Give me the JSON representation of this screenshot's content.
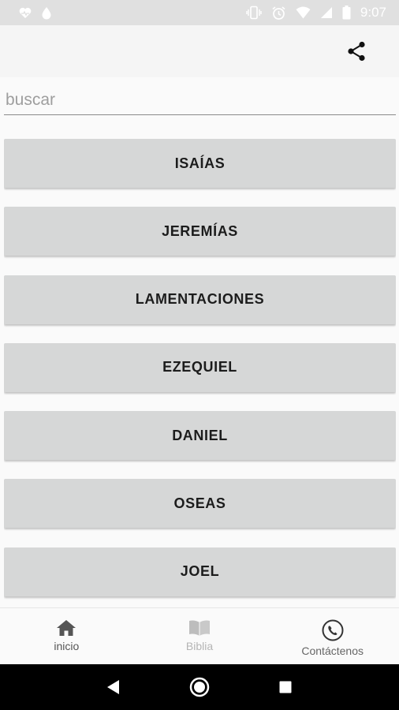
{
  "status_bar": {
    "time": "9:07",
    "left_icons": [
      "heart-monitor-icon",
      "drop-icon"
    ],
    "right_icons": [
      "vibrate-icon",
      "alarm-icon",
      "wifi-icon",
      "battery-icon"
    ]
  },
  "toolbar": {
    "share_icon": "share-icon"
  },
  "search": {
    "placeholder": "buscar",
    "value": ""
  },
  "books": [
    {
      "label": "ISAÍAS"
    },
    {
      "label": "JEREMÍAS"
    },
    {
      "label": "LAMENTACIONES"
    },
    {
      "label": "EZEQUIEL"
    },
    {
      "label": "DANIEL"
    },
    {
      "label": "OSEAS"
    },
    {
      "label": "JOEL"
    }
  ],
  "bottom_nav": {
    "items": [
      {
        "label": "inicio",
        "icon": "home-icon",
        "active": true
      },
      {
        "label": "Biblia",
        "icon": "book-icon",
        "active": false
      },
      {
        "label": "Contáctenos",
        "icon": "phone-icon",
        "active": false
      }
    ]
  },
  "colors": {
    "status_bar": "#e0e0e0",
    "button_bg": "#d6d7d7",
    "background": "#fafafa",
    "system_nav": "#000000"
  }
}
